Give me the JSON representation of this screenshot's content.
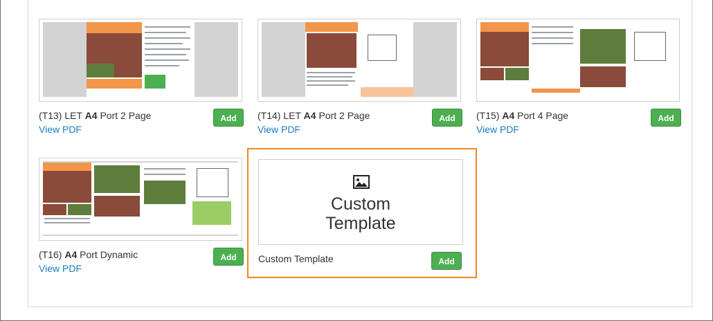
{
  "templates": [
    {
      "code": "(T13) LET ",
      "size": "A4",
      "rest": " Port 2 Page",
      "link": "View PDF",
      "add": "Add"
    },
    {
      "code": "(T14) LET ",
      "size": "A4",
      "rest": " Port 2 Page",
      "link": "View PDF",
      "add": "Add"
    },
    {
      "code": "(T15) ",
      "size": "A4",
      "rest": " Port 4 Page",
      "link": "View PDF",
      "add": "Add"
    },
    {
      "code": "(T16) ",
      "size": "A4",
      "rest": " Port Dynamic",
      "link": "View PDF",
      "add": "Add"
    }
  ],
  "custom": {
    "title_line1": "Custom",
    "title_line2": "Template",
    "caption": "Custom Template",
    "add": "Add",
    "icon": "image-icon"
  },
  "colors": {
    "accent": "#f0891d",
    "add_button": "#4caf50",
    "link": "#1d7cc1"
  }
}
